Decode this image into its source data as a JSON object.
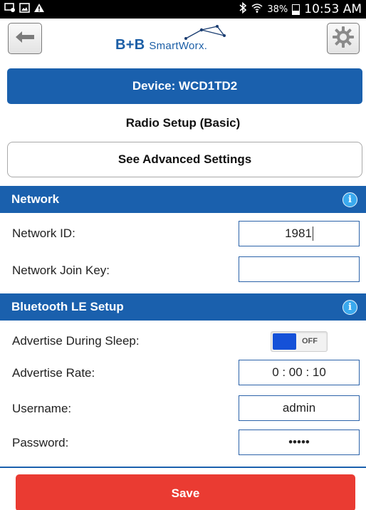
{
  "status_bar": {
    "battery": "38%",
    "time": "10:53 AM"
  },
  "header": {
    "logo_primary": "B+B",
    "logo_secondary": "SmartWorx",
    "logo_suffix": "."
  },
  "device": {
    "title": "Device: WCD1TD2"
  },
  "page": {
    "title": "Radio Setup (Basic)",
    "advanced_button": "See Advanced Settings"
  },
  "network": {
    "header": "Network",
    "info_glyph": "i",
    "network_id_label": "Network ID:",
    "network_id_value": "1981",
    "join_key_label": "Network Join Key:",
    "join_key_value": ""
  },
  "bluetooth": {
    "header": "Bluetooth LE Setup",
    "info_glyph": "i",
    "advertise_sleep_label": "Advertise During Sleep:",
    "advertise_sleep_state": "OFF",
    "advertise_rate_label": "Advertise Rate:",
    "advertise_rate_value": "0 : 00 : 10",
    "username_label": "Username:",
    "username_value": "admin",
    "password_label": "Password:",
    "password_value": "•••••"
  },
  "footer": {
    "save_label": "Save"
  },
  "colors": {
    "brand_blue": "#1a60ad",
    "info_blue": "#3aa9ee",
    "toggle_blue": "#1551d8",
    "save_red": "#ea3b32"
  },
  "icons": [
    "usb-debug-icon",
    "image-icon",
    "warning-icon",
    "bluetooth-icon",
    "wifi-icon",
    "battery-icon",
    "back-arrow-icon",
    "gear-icon",
    "info-icon"
  ]
}
